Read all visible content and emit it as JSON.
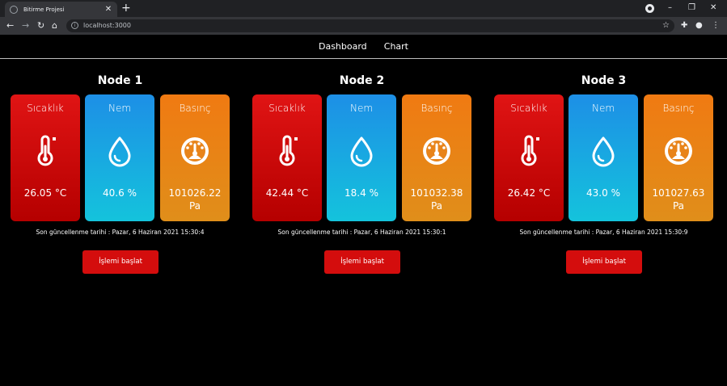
{
  "browser": {
    "tab_title": "Bitirme Projesi",
    "tab_close": "✕",
    "new_tab": "+",
    "url": "localhost:3000",
    "window_controls": {
      "minimize": "–",
      "restore": "❐",
      "close": "✕"
    }
  },
  "nav": {
    "links": [
      "Dashboard",
      "Chart"
    ]
  },
  "labels": {
    "temperature": "Sıcaklık",
    "humidity": "Nem",
    "pressure": "Basınç"
  },
  "nodes": [
    {
      "title": "Node 1",
      "temperature": "26.05 °C",
      "humidity": "40.6 %",
      "pressure_line1": "101026.22",
      "pressure_line2": "Pa",
      "updated": "Son güncellenme tarihi : Pazar, 6 Haziran 2021 15:30:4",
      "button": "İşlemi başlat"
    },
    {
      "title": "Node 2",
      "temperature": "42.44 °C",
      "humidity": "18.4 %",
      "pressure_line1": "101032.38",
      "pressure_line2": "Pa",
      "updated": "Son güncellenme tarihi : Pazar, 6 Haziran 2021 15:30:1",
      "button": "İşlemi başlat"
    },
    {
      "title": "Node 3",
      "temperature": "26.42 °C",
      "humidity": "43.0 %",
      "pressure_line1": "101027.63",
      "pressure_line2": "Pa",
      "updated": "Son güncellenme tarihi : Pazar, 6 Haziran 2021 15:30:9",
      "button": "İşlemi başlat"
    }
  ],
  "icons": {
    "temperature": "thermometer-icon",
    "humidity": "water-drop-icon",
    "pressure": "gauge-icon"
  },
  "colors": {
    "temperature_card": "#d40d0d",
    "humidity_card": "#1aa6e2",
    "pressure_card": "#e8841a",
    "button": "#d40d0d"
  }
}
